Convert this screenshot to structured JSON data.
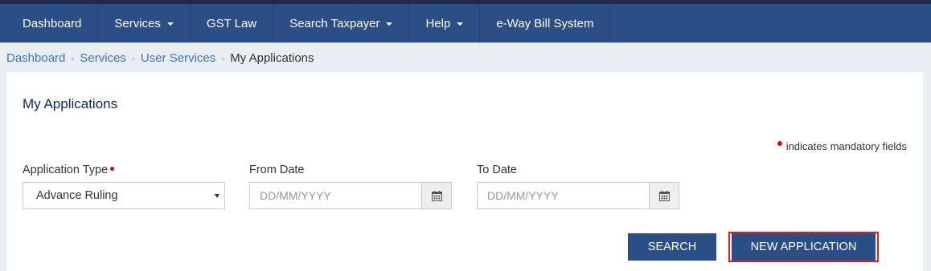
{
  "nav": {
    "items": [
      {
        "label": "Dashboard",
        "has_caret": false
      },
      {
        "label": "Services",
        "has_caret": true
      },
      {
        "label": "GST Law",
        "has_caret": false
      },
      {
        "label": "Search Taxpayer",
        "has_caret": true
      },
      {
        "label": "Help",
        "has_caret": true
      },
      {
        "label": "e-Way Bill System",
        "has_caret": false
      }
    ]
  },
  "breadcrumb": {
    "items": [
      "Dashboard",
      "Services",
      "User Services"
    ],
    "current": "My Applications"
  },
  "panel": {
    "title": "My Applications",
    "mandatory_note": "indicates mandatory fields"
  },
  "form": {
    "application_type": {
      "label": "Application Type",
      "value": "Advance Ruling"
    },
    "from_date": {
      "label": "From Date",
      "placeholder": "DD/MM/YYYY"
    },
    "to_date": {
      "label": "To Date",
      "placeholder": "DD/MM/YYYY"
    }
  },
  "actions": {
    "search_label": "SEARCH",
    "new_application_label": "NEW APPLICATION"
  },
  "colors": {
    "primary": "#2c4e86",
    "link": "#3d75b3",
    "mandatory": "#e20000",
    "highlight_border": "#e21c23"
  }
}
